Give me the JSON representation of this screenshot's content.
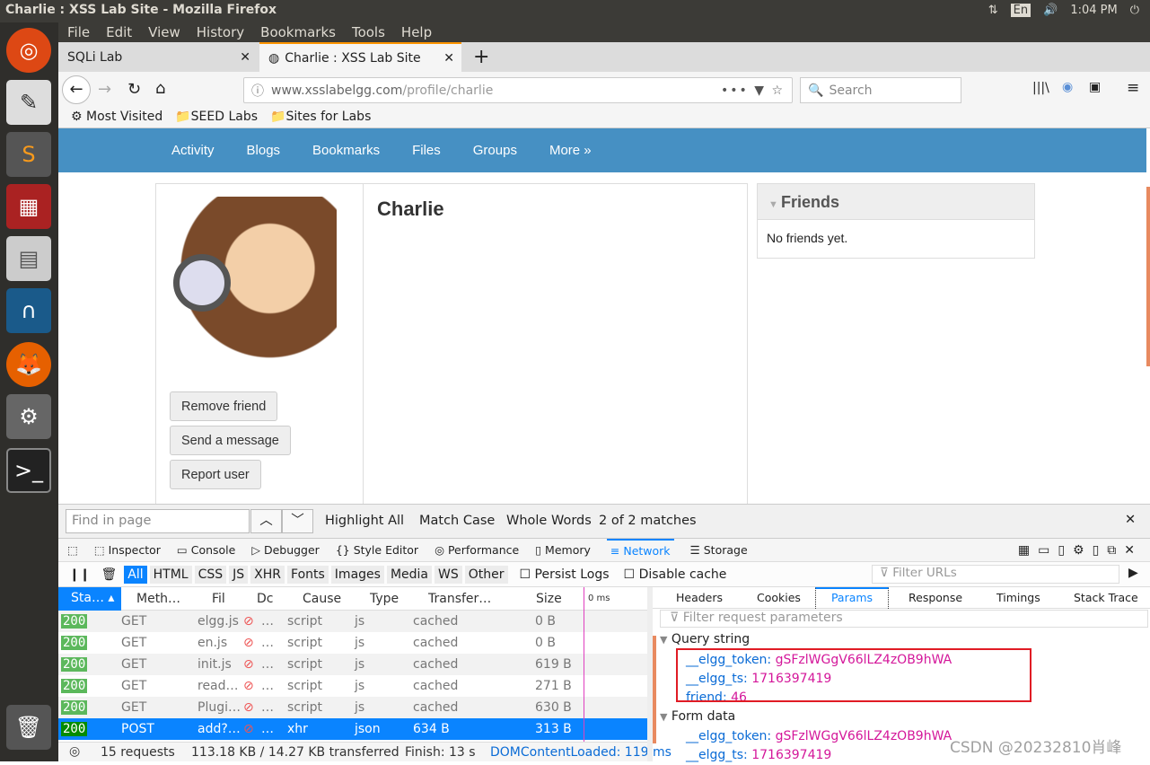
{
  "os": {
    "window_title": "Charlie : XSS Lab Site - Mozilla Firefox",
    "keyboard": "En",
    "time": "1:04 PM"
  },
  "menu": [
    "File",
    "Edit",
    "View",
    "History",
    "Bookmarks",
    "Tools",
    "Help"
  ],
  "tabs": [
    {
      "label": "SQLi Lab",
      "active": false
    },
    {
      "label": "Charlie : XSS Lab Site",
      "active": true
    }
  ],
  "url": {
    "host": "www.xsslabelgg.com",
    "path": "/profile/charlie"
  },
  "search_placeholder": "Search",
  "bookmarks": [
    "Most Visited",
    "SEED Labs",
    "Sites for Labs"
  ],
  "site": {
    "nav": [
      "Activity",
      "Blogs",
      "Bookmarks",
      "Files",
      "Groups",
      "More »"
    ],
    "profile_name": "Charlie",
    "buttons": [
      "Remove friend",
      "Send a message",
      "Report user"
    ],
    "friends_title": "Friends",
    "friends_text": "No friends yet."
  },
  "find": {
    "placeholder": "Find in page",
    "highlight_all": "Highlight All",
    "match_case": "Match Case",
    "whole_words": "Whole Words",
    "matches": "2 of 2 matches"
  },
  "devtools": {
    "tabs": [
      "Inspector",
      "Console",
      "Debugger",
      "Style Editor",
      "Performance",
      "Memory",
      "Network",
      "Storage"
    ],
    "active_tab": "Network",
    "filters": [
      "All",
      "HTML",
      "CSS",
      "JS",
      "XHR",
      "Fonts",
      "Images",
      "Media",
      "WS",
      "Other"
    ],
    "persist_logs": "Persist Logs",
    "disable_cache": "Disable cache",
    "filter_urls_placeholder": "Filter URLs",
    "columns": [
      "Sta…",
      "Meth…",
      "Fil",
      "Dc",
      "Cause",
      "Type",
      "Transfer…",
      "Size",
      "0 ms"
    ],
    "rows": [
      {
        "status": "200",
        "method": "GET",
        "file": "elgg.js",
        "domain": "…",
        "cause": "script",
        "type": "js",
        "transferred": "cached",
        "size": "0 B"
      },
      {
        "status": "200",
        "method": "GET",
        "file": "en.js",
        "domain": "…",
        "cause": "script",
        "type": "js",
        "transferred": "cached",
        "size": "0 B"
      },
      {
        "status": "200",
        "method": "GET",
        "file": "init.js",
        "domain": "…",
        "cause": "script",
        "type": "js",
        "transferred": "cached",
        "size": "619 B"
      },
      {
        "status": "200",
        "method": "GET",
        "file": "read…",
        "domain": "…",
        "cause": "script",
        "type": "js",
        "transferred": "cached",
        "size": "271 B"
      },
      {
        "status": "200",
        "method": "GET",
        "file": "Plugi…",
        "domain": "…",
        "cause": "script",
        "type": "js",
        "transferred": "cached",
        "size": "630 B"
      },
      {
        "status": "200",
        "method": "POST",
        "file": "add?…",
        "domain": "…",
        "cause": "xhr",
        "type": "json",
        "transferred": "634 B",
        "size": "313 B",
        "selected": true
      }
    ],
    "summary": {
      "requests": "15 requests",
      "transferred": "113.18 KB / 14.27 KB transferred",
      "finish": "Finish: 13 s",
      "dom": "DOMContentLoaded: 119 ms"
    },
    "detail_tabs": [
      "Headers",
      "Cookies",
      "Params",
      "Response",
      "Timings",
      "Stack Trace"
    ],
    "active_detail": "Params",
    "filter_params_placeholder": "Filter request parameters",
    "query_title": "Query string",
    "query": [
      {
        "k": "__elgg_token:",
        "v": "gSFzlWGgV66lLZ4zOB9hWA"
      },
      {
        "k": "__elgg_ts:",
        "v": "1716397419"
      },
      {
        "k": "friend:",
        "v": "46"
      }
    ],
    "form_title": "Form data",
    "form": [
      {
        "k": "__elgg_token:",
        "v": "gSFzlWGgV66lLZ4zOB9hWA"
      },
      {
        "k": "__elgg_ts:",
        "v": "1716397419"
      }
    ]
  },
  "watermark": "CSDN @20232810肖峰"
}
